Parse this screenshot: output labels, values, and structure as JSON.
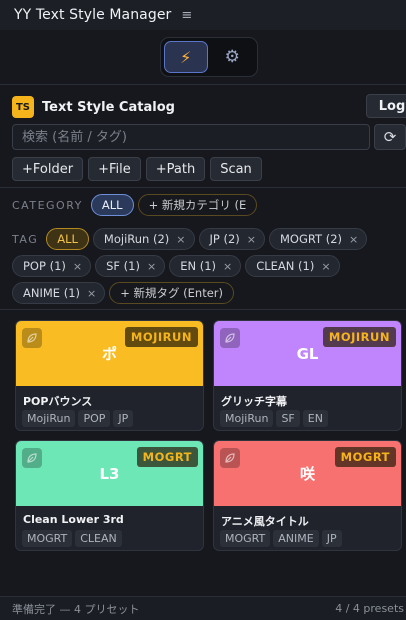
{
  "app": {
    "title": "YY Text Style Manager"
  },
  "catalog": {
    "badge": "TS",
    "title": "Text Style Catalog",
    "log_label": "Log"
  },
  "search": {
    "placeholder": "検索 (名前 / タグ)",
    "value": ""
  },
  "actions": [
    "+Folder",
    "+File",
    "+Path",
    "Scan"
  ],
  "category": {
    "label": "CATEGORY",
    "selected": "ALL",
    "new_label": "+ 新規カテゴリ (E"
  },
  "tags": {
    "label": "TAG",
    "all_label": "ALL",
    "items": [
      "MojiRun (2)",
      "JP (2)",
      "MOGRT (2)",
      "POP (1)",
      "SF (1)",
      "EN (1)",
      "CLEAN (1)",
      "ANIME (1)"
    ],
    "remove_glyph": "×",
    "new_label": "+ 新規タグ (Enter)"
  },
  "cards": [
    {
      "glyph": "ポ",
      "badge": "MOJIRUN",
      "name": "POPバウンス",
      "color": "#f9bd23",
      "tags": [
        "MojiRun",
        "POP",
        "JP"
      ]
    },
    {
      "glyph": "GL",
      "badge": "MOJIRUN",
      "name": "グリッチ字幕",
      "color": "#c084fc",
      "tags": [
        "MojiRun",
        "SF",
        "EN"
      ]
    },
    {
      "glyph": "L3",
      "badge": "MOGRT",
      "name": "Clean Lower 3rd",
      "color": "#6ee7b7",
      "tags": [
        "MOGRT",
        "CLEAN"
      ]
    },
    {
      "glyph": "咲",
      "badge": "MOGRT",
      "name": "アニメ風タイトル",
      "color": "#f87171",
      "tags": [
        "MOGRT",
        "ANIME",
        "JP"
      ]
    }
  ],
  "status": {
    "left": "準備完了 — 4 プリセット",
    "right": "4 / 4 presets"
  },
  "colors": {
    "accent_gold": "#f5b41c",
    "selected_blue": "#6d8fd8",
    "background": "#16181d"
  },
  "icons": {
    "mode_active": "lightning-icon",
    "mode_settings": "gear-icon",
    "refresh": "refresh-icon",
    "menu": "hamburger-icon",
    "card_type": "leaf-icon"
  }
}
